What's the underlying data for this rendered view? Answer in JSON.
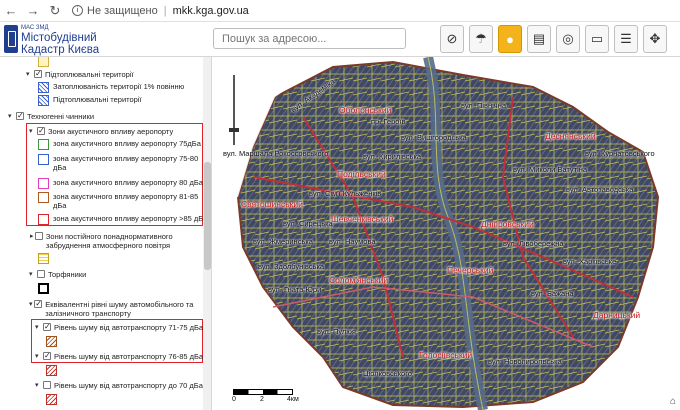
{
  "browser": {
    "back_icon": "arrow-left-icon",
    "forward_icon": "arrow-right-icon",
    "reload_icon": "reload-icon",
    "security_label": "Не защищено",
    "url": "mkk.kga.gov.ua"
  },
  "header": {
    "org_label": "МАС ЗМД",
    "title_line1": "Містобудівний",
    "title_line2": "Кадастр Києва",
    "search_placeholder": "Пошук за адресою...",
    "tools": [
      "no-layers-icon",
      "umbrella-icon",
      "pegman-icon",
      "clipboard-icon",
      "compass-icon",
      "ruler-icon",
      "layers-panel-icon",
      "move-icon"
    ]
  },
  "sidebar": {
    "items": [
      {
        "type": "swatch",
        "label": ""
      },
      {
        "type": "group",
        "label": "Підтоплювальні території"
      },
      {
        "type": "legend",
        "label": "Затоплюваність території 1% повінню"
      },
      {
        "type": "legend",
        "label": "Підтоплювальні території"
      },
      {
        "type": "group",
        "label": "Техногенні чинники"
      },
      {
        "type": "group",
        "label": "Зони акустичного впливу аеропорту"
      },
      {
        "type": "legend",
        "label": "зона акустичного впливу аеропорту 75дБа"
      },
      {
        "type": "legend",
        "label": "зона акустичного впливу аеропорту 75-80 дБа"
      },
      {
        "type": "legend",
        "label": "зона акустичного впливу аеропорту 80 дБа"
      },
      {
        "type": "legend",
        "label": "зона акустичного впливу аеропорту 81-85 дБа"
      },
      {
        "type": "legend",
        "label": "зона акустичного впливу аеропорту >85 дБа"
      },
      {
        "type": "group",
        "label": "Зони постійного понаднормативного забруднення атмосферного повітря"
      },
      {
        "type": "group",
        "label": "Торфяники"
      },
      {
        "type": "group",
        "label": "Еквівалентні рівні шуму автомобільного та залізничного транспорту"
      },
      {
        "type": "group",
        "label": "Рівень шуму від автотранспорту 71-75 дБа"
      },
      {
        "type": "group",
        "label": "Рівень шуму від автотранспорту 76-85 дБа"
      },
      {
        "type": "group",
        "label": "Рівень шуму від автотранспорту до 70 дБа"
      }
    ],
    "swatch_colors": {
      "zone75": "#3a9a3a",
      "zone75_80": "#3a5fd0",
      "zone80": "#e040c0",
      "zone81_85": "#b05a20",
      "zone85": "#e0232a"
    }
  },
  "map": {
    "districts": [
      "Оболонський",
      "Деснянський",
      "Подільський",
      "Святошинський",
      "Шевченківський",
      "Дніпровський",
      "Солом'янський",
      "Печерський",
      "Дарницький",
      "Голосіївський"
    ],
    "street_labels": [
      "вул. Академіка",
      "вул. Маршала Рокоссовського",
      "вул. Північна",
      "пр. Героїв",
      "вул. Сім'ї Кульженків",
      "вул. Миколи Ватутіна",
      "вул. Автозаводська",
      "вул. Кирилівська",
      "вул. Жмеринська",
      "вул. Харківське",
      "вул. Наумова",
      "вул. Гната Юри",
      "вул. Пулюя",
      "Ціолковського",
      "вул. Лівобережна",
      "вул. Бажана",
      "вул. Новопирогівська",
      "вул. Здолбунівська",
      "вул. Сирецька",
      "вул. Курнатовського",
      "вул. Вишгородська"
    ],
    "scale_labels": [
      "0",
      "2",
      "4км"
    ]
  }
}
